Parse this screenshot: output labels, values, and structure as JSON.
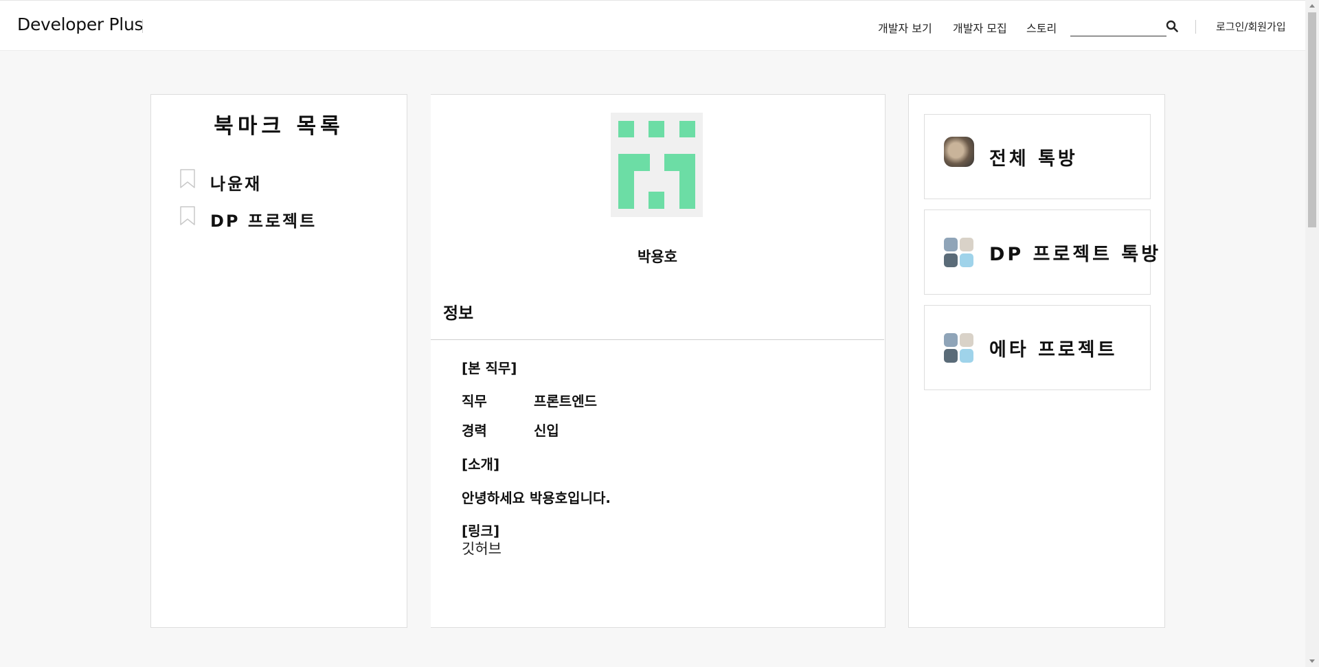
{
  "header": {
    "logo": "Developer Plus",
    "nav": [
      "개발자 보기",
      "개발자 모집",
      "스토리"
    ],
    "search": {
      "value": "",
      "placeholder": ""
    },
    "login": "로그인/회원가입"
  },
  "bookmarks": {
    "title": "북마크 목록",
    "items": [
      {
        "label": "나윤재"
      },
      {
        "label": "DP 프로젝트"
      }
    ]
  },
  "profile": {
    "name": "박용호",
    "section_title": "정보",
    "job_heading": "[본 직무]",
    "job_label": "직무",
    "job_value": "프론트엔드",
    "career_label": "경력",
    "career_value": "신입",
    "intro_heading": "[소개]",
    "intro_text": "안녕하세요 박용호입니다.",
    "link_heading": "[링크]",
    "link_text": "깃허브",
    "avatar_color": "#6cdda5"
  },
  "chats": [
    {
      "title": "전체 톡방",
      "avatar": "single-photo"
    },
    {
      "title": "DP 프로젝트 톡방",
      "avatar": "group-photos"
    },
    {
      "title": "에타 프로젝트",
      "avatar": "group-photos"
    }
  ]
}
